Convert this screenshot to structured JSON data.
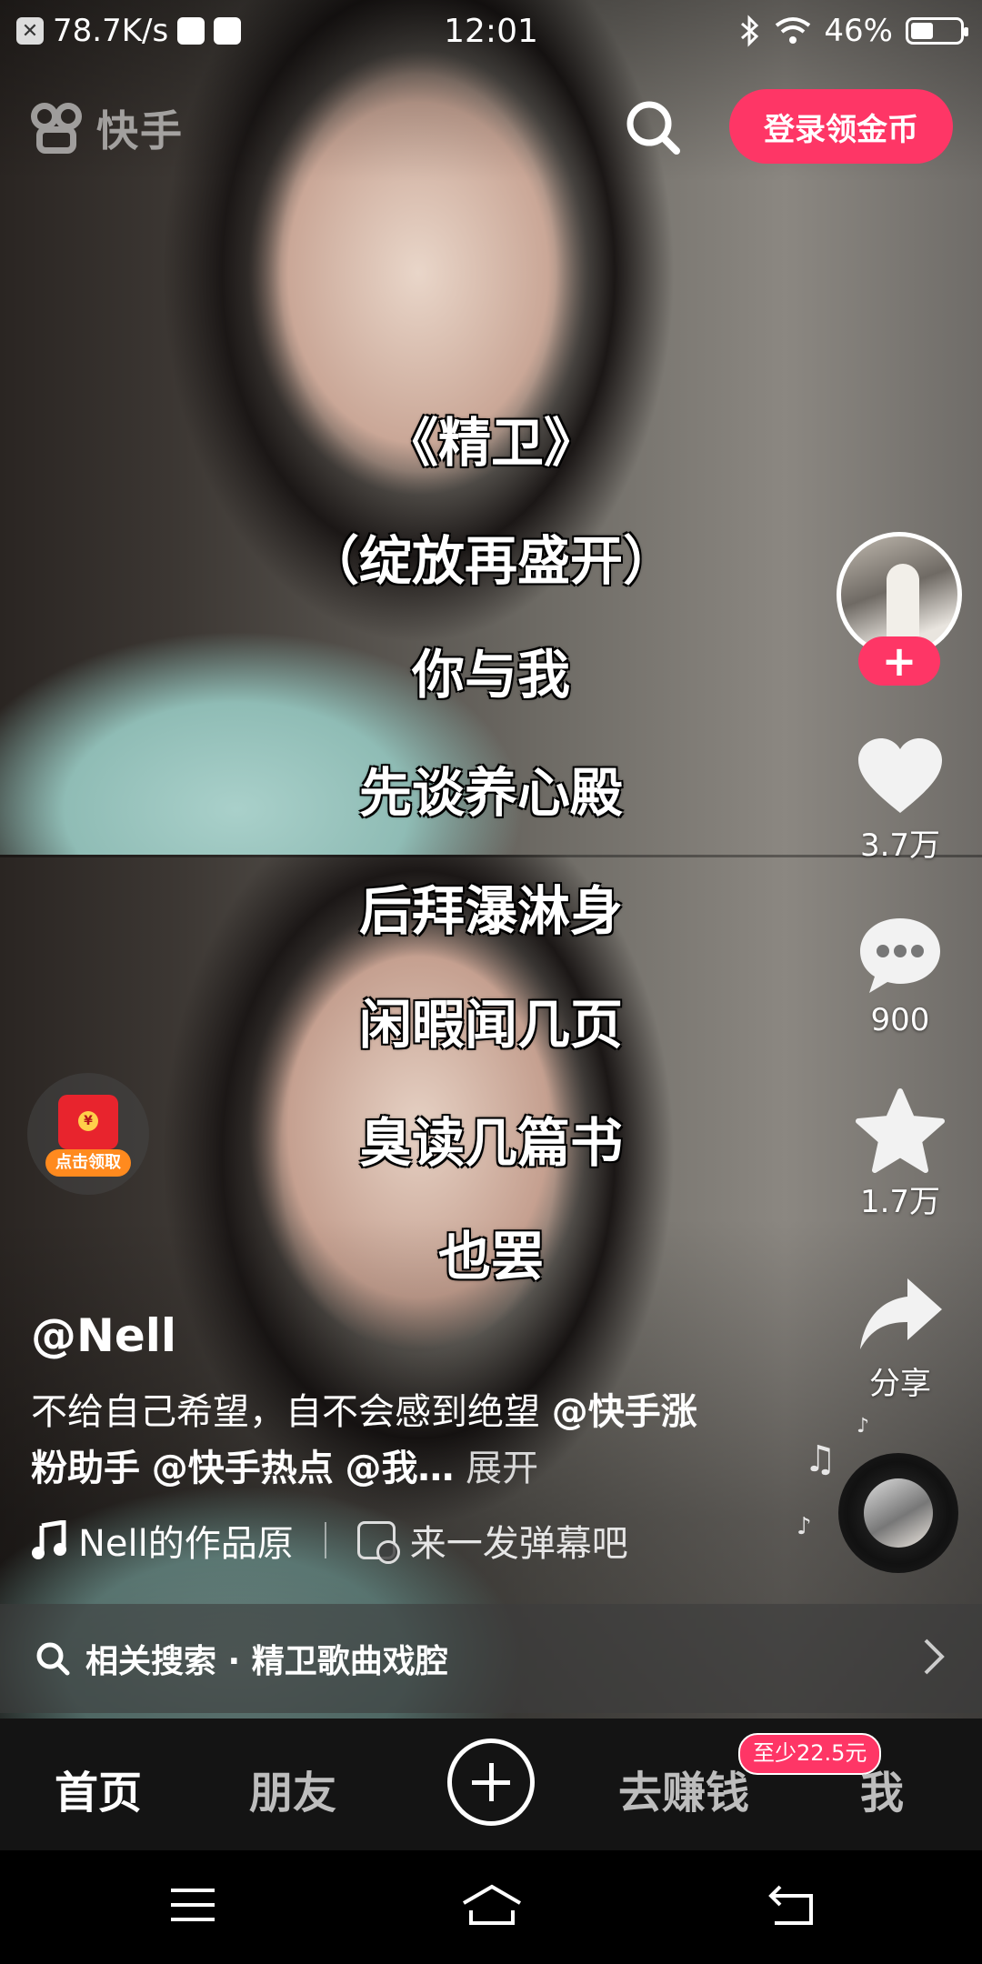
{
  "status_bar": {
    "speed": "78.7K/s",
    "time": "12:01",
    "battery": "46%",
    "battery_level": 0.46
  },
  "header": {
    "logo_text": "快手",
    "login_button": "登录领金币"
  },
  "lyrics": [
    "《精卫》",
    "（绽放再盛开）",
    "你与我",
    "先谈养心殿",
    "后拜瀑淋身",
    "闲暇闻几页",
    "臭读几篇书",
    "也罢"
  ],
  "side_actions": {
    "likes": "3.7万",
    "comments": "900",
    "favorites": "1.7万",
    "share": "分享"
  },
  "red_packet": {
    "label": "点击领取",
    "coin": "¥"
  },
  "post": {
    "author": "@Nell",
    "desc_text": "不给自己希望，自不会感到绝望",
    "mention_1": "@快手涨粉助手",
    "mention_2": "@快手热点",
    "mention_3": "@我…",
    "expand": "展开",
    "music": "Nell的作品原",
    "danmu": "来一发弹幕吧"
  },
  "related_search": {
    "text": "相关搜索 · 精卫歌曲戏腔"
  },
  "bottom_nav": {
    "home": "首页",
    "friends": "朋友",
    "earn": "去赚钱",
    "earn_badge": "至少22.5元",
    "me": "我"
  }
}
